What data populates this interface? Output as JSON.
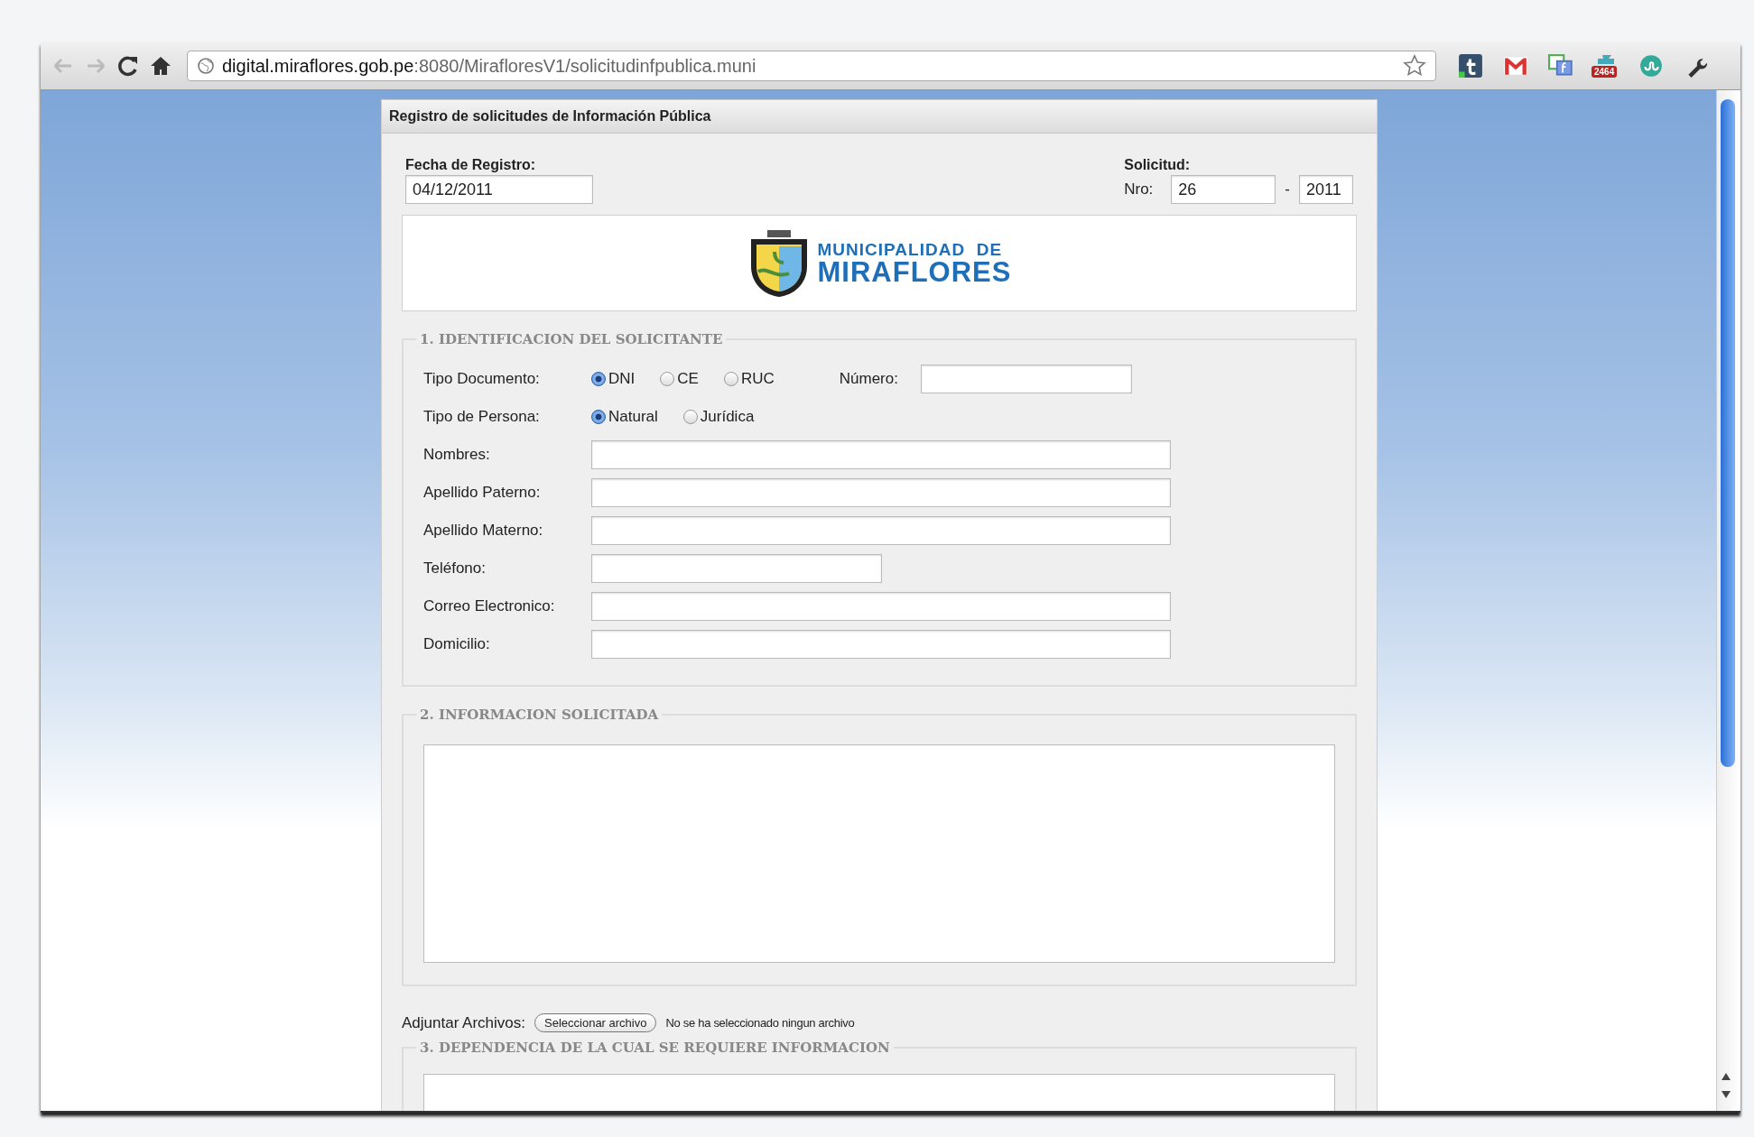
{
  "browser": {
    "url_host": "digital.miraflores.gob.pe",
    "url_path": ":8080/MirafloresV1/solicitudinfpublica.muni",
    "extensions": [
      {
        "kind": "tumblr"
      },
      {
        "kind": "mail"
      },
      {
        "kind": "chat"
      },
      {
        "kind": "counter",
        "badge": "2464"
      },
      {
        "kind": "stumble"
      },
      {
        "kind": "wrench"
      }
    ]
  },
  "form": {
    "title": "Registro de solicitudes de Información Pública",
    "fecha_label": "Fecha de Registro:",
    "fecha_value": "04/12/2011",
    "solicitud_label": "Solicitud:",
    "nro_label": "Nro:",
    "nro_value": "26",
    "separator": "-",
    "year_value": "2011",
    "logo": {
      "line1": "MUNICIPALIDAD  DE",
      "line2": "MIRAFLORES"
    },
    "section1": {
      "legend": "1. IDENTIFICACION DEL SOLICITANTE",
      "rows": [
        {
          "kind": "radio",
          "label": "Tipo Documento:",
          "options": [
            {
              "label": "DNI",
              "selected": true
            },
            {
              "label": "CE",
              "selected": false
            },
            {
              "label": "RUC",
              "selected": false
            }
          ],
          "extra_label": "Número:"
        },
        {
          "kind": "radio",
          "label": "Tipo de Persona:",
          "options": [
            {
              "label": "Natural",
              "selected": true
            },
            {
              "label": "Jurídica",
              "selected": false
            }
          ]
        },
        {
          "kind": "text",
          "label": "Nombres:"
        },
        {
          "kind": "text",
          "label": "Apellido Paterno:"
        },
        {
          "kind": "text",
          "label": "Apellido Materno:"
        },
        {
          "kind": "short_text",
          "label": "Teléfono:"
        },
        {
          "kind": "text",
          "label": "Correo Electronico:"
        },
        {
          "kind": "text",
          "label": "Domicilio:"
        }
      ]
    },
    "section2": {
      "legend": "2. INFORMACION SOLICITADA"
    },
    "attach": {
      "label": "Adjuntar Archivos:",
      "button": "Seleccionar archivo",
      "status": "No se ha seleccionado ningun archivo"
    },
    "section3": {
      "legend": "3. DEPENDENCIA DE LA CUAL SE REQUIERE INFORMACION"
    }
  }
}
